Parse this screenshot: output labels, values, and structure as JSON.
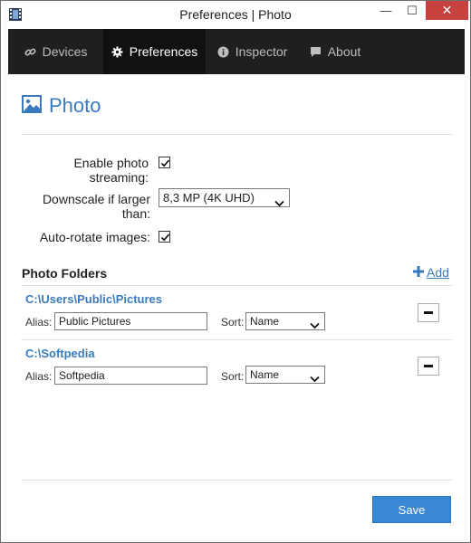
{
  "window": {
    "title": "Preferences | Photo",
    "minimize_glyph": "—",
    "maximize_glyph": "☐",
    "close_glyph": "✕"
  },
  "tabs": [
    {
      "label": "Devices",
      "icon": "link-icon",
      "active": false
    },
    {
      "label": "Preferences",
      "icon": "gear-icon",
      "active": true
    },
    {
      "label": "Inspector",
      "icon": "info-icon",
      "active": false
    },
    {
      "label": "About",
      "icon": "chat-icon",
      "active": false
    }
  ],
  "section": {
    "title": "Photo",
    "icon": "picture-icon"
  },
  "settings": {
    "streaming_label": "Enable photo streaming:",
    "streaming_checked": true,
    "downscale_label": "Downscale if larger than:",
    "downscale_value": "8,3 MP (4K UHD)",
    "autorotate_label": "Auto-rotate images:",
    "autorotate_checked": true
  },
  "folders": {
    "title": "Photo Folders",
    "add_label": "Add",
    "alias_label": "Alias:",
    "sort_label": "Sort:",
    "items": [
      {
        "path": "C:\\Users\\Public\\Pictures",
        "alias": "Public Pictures",
        "sort": "Name"
      },
      {
        "path": "C:\\Softpedia",
        "alias": "Softpedia",
        "sort": "Name"
      }
    ]
  },
  "footer": {
    "save_label": "Save"
  },
  "colors": {
    "accent": "#3a7bbf",
    "tabbar": "#1f1f1f",
    "close": "#c7423f",
    "button": "#3a87d6"
  }
}
